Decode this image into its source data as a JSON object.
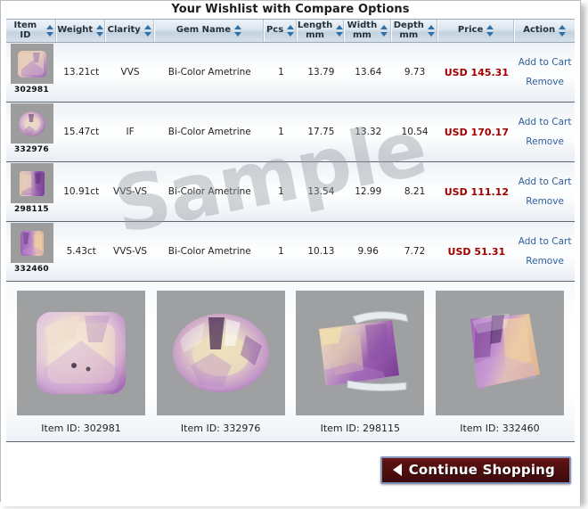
{
  "window": {
    "title": "Your Wishlist with Compare Options"
  },
  "table": {
    "columns": [
      {
        "label": "Item ID",
        "sortable": true
      },
      {
        "label": "Weight",
        "sortable": true
      },
      {
        "label": "Clarity",
        "sortable": true
      },
      {
        "label": "Gem Name",
        "sortable": true
      },
      {
        "label": "Pcs",
        "sortable": true
      },
      {
        "label": "Length\nmm",
        "sortable": true
      },
      {
        "label": "Width\nmm",
        "sortable": true
      },
      {
        "label": "Depth\nmm",
        "sortable": true
      },
      {
        "label": "Price",
        "sortable": true
      },
      {
        "label": "Action",
        "sortable": true
      }
    ],
    "rows": [
      {
        "item_id": "302981",
        "weight": "13.21ct",
        "clarity": "VVS",
        "gem_name": "Bi-Color Ametrine",
        "pcs": "1",
        "length": "13.79",
        "width": "13.64",
        "depth": "9.73",
        "price": "USD 145.31",
        "add_to_cart": "Add to Cart",
        "remove": "Remove"
      },
      {
        "item_id": "332976",
        "weight": "15.47ct",
        "clarity": "IF",
        "gem_name": "Bi-Color Ametrine",
        "pcs": "1",
        "length": "17.75",
        "width": "13.32",
        "depth": "10.54",
        "price": "USD 170.17",
        "add_to_cart": "Add to Cart",
        "remove": "Remove"
      },
      {
        "item_id": "298115",
        "weight": "10.91ct",
        "clarity": "VVS-VS",
        "gem_name": "Bi-Color Ametrine",
        "pcs": "1",
        "length": "13.54",
        "width": "12.99",
        "depth": "8.21",
        "price": "USD 111.12",
        "add_to_cart": "Add to Cart",
        "remove": "Remove"
      },
      {
        "item_id": "332460",
        "weight": "5.43ct",
        "clarity": "VVS-VS",
        "gem_name": "Bi-Color Ametrine",
        "pcs": "1",
        "length": "10.13",
        "width": "9.96",
        "depth": "7.72",
        "price": "USD 51.31",
        "add_to_cart": "Add to Cart",
        "remove": "Remove"
      }
    ]
  },
  "watermark": {
    "text": "Sample"
  },
  "gallery": {
    "items": [
      {
        "caption": "Item ID: 302981"
      },
      {
        "caption": "Item ID: 332976"
      },
      {
        "caption": "Item ID: 298115"
      },
      {
        "caption": "Item ID: 332460"
      }
    ]
  },
  "footer": {
    "continue_shopping": "Continue Shopping"
  },
  "colors": {
    "price": "#a00000",
    "link": "#2d5fa0",
    "header_text": "#24303c",
    "sort_arrow": "#2f6fa8",
    "button_bg": "#5a1111",
    "button_border": "#7f93b8"
  }
}
